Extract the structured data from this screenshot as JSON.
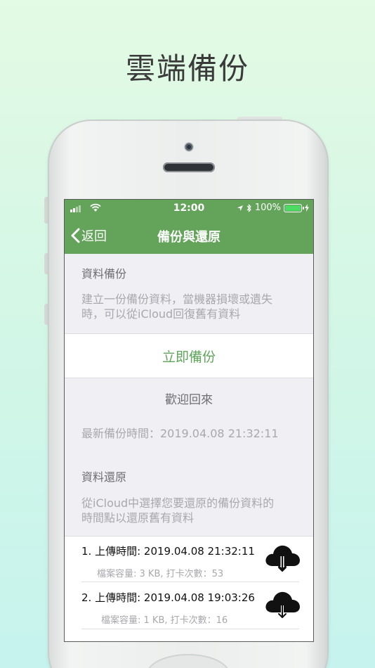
{
  "headline": "雲端備份",
  "status_bar": {
    "time": "12:00",
    "battery_percent": "100%",
    "battery_color": "#4cd964"
  },
  "nav": {
    "back_label": "返回",
    "title": "備份與還原",
    "bar_color": "#64a35a"
  },
  "backup": {
    "header": "資料備份",
    "desc_line1": "建立一份備份資料，當機器損壞或遺失",
    "desc_line2": "時，可以從iCloud回復舊有資料",
    "button_label": "立即備份"
  },
  "welcome": "歡迎回來",
  "latest_backup": "最新備份時間：2019.04.08  21:32:11",
  "restore": {
    "header": "資料還原",
    "desc_line1": "從iCloud中選擇您要還原的備份資料的",
    "desc_line2": "時間點以還原舊有資料"
  },
  "backups": [
    {
      "title": "1. 上傳時間: 2019.04.08   21:32:11",
      "detail": "檔案容量: 3 KB, 打卡次數：53",
      "icon": "cloud-download-icon"
    },
    {
      "title": "2. 上傳時間: 2019.04.08   19:03:26",
      "detail": "檔案容量: 1 KB, 打卡次數：16",
      "icon": "cloud-download-icon"
    }
  ]
}
